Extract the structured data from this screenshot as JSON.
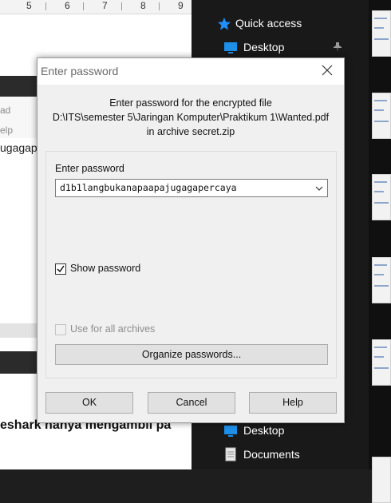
{
  "background_doc": {
    "ruler_ticks": [
      "5",
      "6",
      "7",
      "8",
      "9"
    ],
    "ribbon_fragments": [
      "ad",
      "elp"
    ],
    "text_fragment": "ugagap",
    "bold_text": "eshark hanya mengambil pa"
  },
  "explorer": {
    "quick_access_label": "Quick access",
    "items_top": [
      {
        "label": "Desktop",
        "icon": "desktop-icon"
      }
    ],
    "items_bottom": [
      {
        "label": "Desktop",
        "icon": "desktop-icon"
      },
      {
        "label": "Documents",
        "icon": "documents-icon"
      }
    ]
  },
  "dialog": {
    "title": "Enter password",
    "message_line1": "Enter password for the encrypted file",
    "message_line2": "D:\\ITS\\semester 5\\Jaringan Komputer\\Praktikum 1\\Wanted.pdf",
    "message_line3": "in archive secret.zip",
    "password_label": "Enter password",
    "password_value": "d1b1langbukanapaapajugagapercaya",
    "show_password_label": "Show password",
    "show_password_checked": true,
    "use_for_all_label": "Use for all archives",
    "use_for_all_checked": false,
    "organize_label": "Organize passwords...",
    "ok_label": "OK",
    "cancel_label": "Cancel",
    "help_label": "Help"
  },
  "colors": {
    "accent_blue": "#1e90ff",
    "dialog_bg": "#f0f0f0",
    "explorer_bg": "#191919"
  }
}
